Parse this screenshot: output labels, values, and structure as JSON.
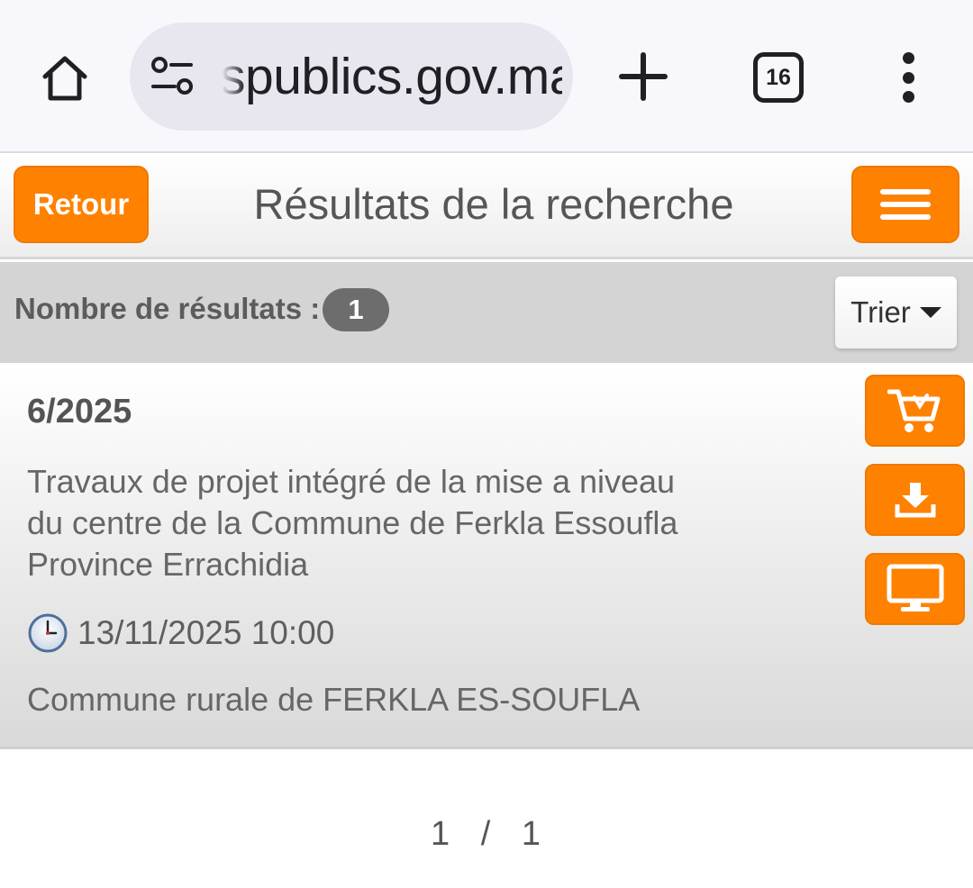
{
  "browser": {
    "url": "spublics.gov.ma",
    "tab_count": "16",
    "icons": {
      "home": "home-icon",
      "site_settings": "tune-icon",
      "new_tab": "plus-icon",
      "tabs": "tab-switcher-icon",
      "menu": "more-vert-icon"
    }
  },
  "header": {
    "back_label": "Retour",
    "title": "Résultats de la recherche",
    "menu_icon": "hamburger-icon"
  },
  "results_bar": {
    "count_label": "Nombre de résultats :",
    "count": "1",
    "sort_label": "Trier"
  },
  "result": {
    "reference": "6/2025",
    "description": "Travaux de projet intégré de la mise a niveau du centre de la Commune de Ferkla Essoufla Province Errachidia",
    "deadline": "13/11/2025 10:00",
    "buyer": "Commune rurale de FERKLA ES-SOUFLA",
    "actions": [
      "cart-icon",
      "download-icon",
      "monitor-icon"
    ]
  },
  "pagination": {
    "current": "1",
    "separator": "/",
    "total": "1"
  },
  "colors": {
    "accent": "#ff8100",
    "count_bar": "#d4d4d4",
    "badge": "#6d6d6d"
  }
}
